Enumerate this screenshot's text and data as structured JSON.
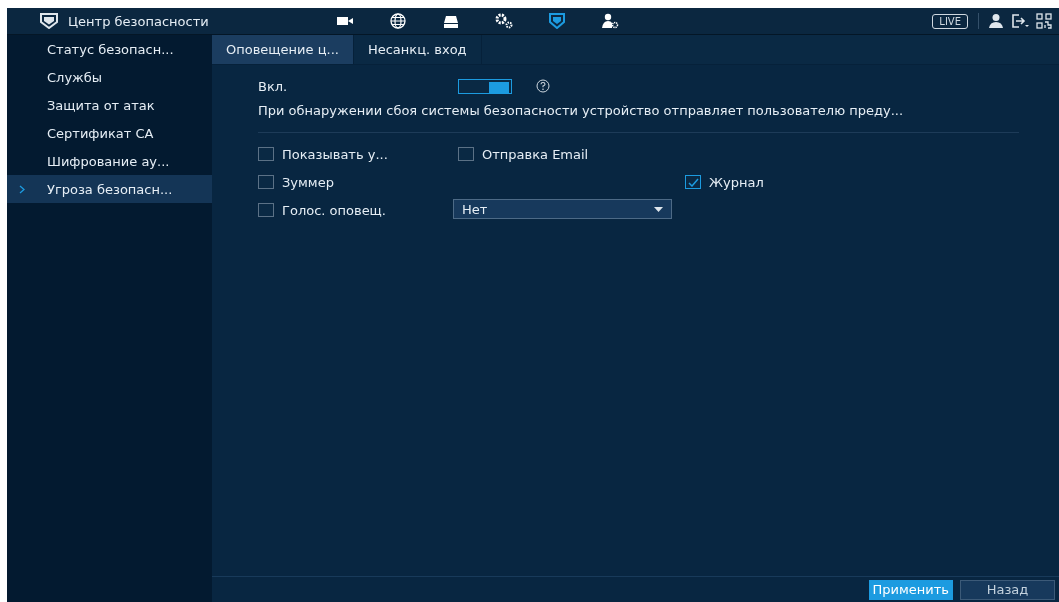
{
  "header": {
    "title": "Центр безопасности",
    "nav": [
      {
        "kind": "camera",
        "selected": false
      },
      {
        "kind": "network",
        "selected": false
      },
      {
        "kind": "storage",
        "selected": false
      },
      {
        "kind": "system",
        "selected": false
      },
      {
        "kind": "security",
        "selected": true
      },
      {
        "kind": "account",
        "selected": false
      }
    ],
    "live": "LIVE"
  },
  "sidebar": {
    "items": [
      {
        "label": "Статус безопасн...",
        "selected": false
      },
      {
        "label": "Службы",
        "selected": false
      },
      {
        "label": "Защита от атак",
        "selected": false
      },
      {
        "label": "Сертификат CA",
        "selected": false
      },
      {
        "label": "Шифрование ау...",
        "selected": false
      },
      {
        "label": "Угроза безопасн...",
        "selected": true
      }
    ]
  },
  "tabs": [
    {
      "label": "Оповещение ц...",
      "selected": true
    },
    {
      "label": "Несанкц. вход",
      "selected": false
    }
  ],
  "enable": {
    "label": "Вкл.",
    "on": true
  },
  "description": "При обнаружении сбоя системы безопасности устройство отправляет пользователю преду...",
  "options": [
    [
      {
        "label": "Показывать у...",
        "checked": false
      },
      {
        "label": "Отправка Email",
        "checked": false
      }
    ],
    [
      {
        "label": "Зуммер",
        "checked": false
      },
      {
        "label": "Журнал",
        "checked": true
      }
    ],
    [
      {
        "label": "Голос. оповещ.",
        "checked": false,
        "select": "Нет"
      }
    ]
  ],
  "buttons": [
    {
      "label": "Применить",
      "primary": true
    },
    {
      "label": "Назад",
      "primary": false
    }
  ]
}
